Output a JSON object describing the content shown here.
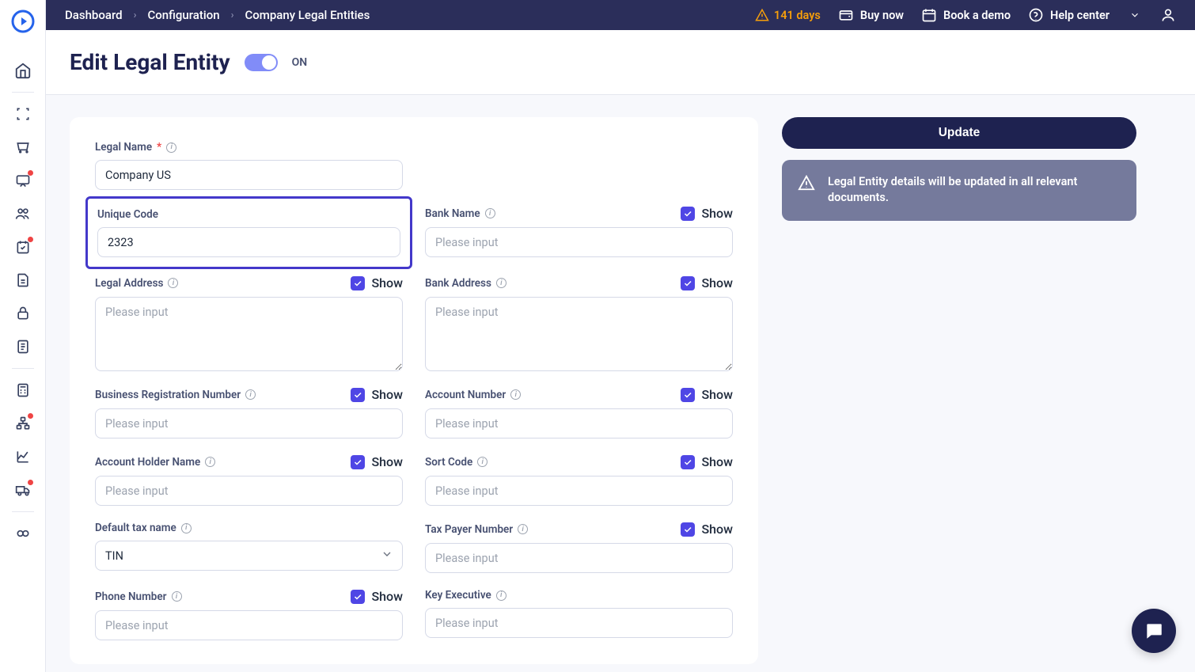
{
  "breadcrumb": [
    "Dashboard",
    "Configuration",
    "Company Legal Entities"
  ],
  "topbar": {
    "days": "141 days",
    "buy_now": "Buy now",
    "book_demo": "Book a demo",
    "help_center": "Help center"
  },
  "header": {
    "title": "Edit Legal Entity",
    "toggle_label": "ON"
  },
  "form": {
    "placeholder": "Please input",
    "show_label": "Show",
    "legal_name": {
      "label": "Legal Name",
      "value": "Company US"
    },
    "unique_code": {
      "label": "Unique Code",
      "value": "2323"
    },
    "bank_name": {
      "label": "Bank Name",
      "value": ""
    },
    "legal_address": {
      "label": "Legal Address",
      "value": ""
    },
    "bank_address": {
      "label": "Bank Address",
      "value": ""
    },
    "brn": {
      "label": "Business Registration Number",
      "value": ""
    },
    "account_number": {
      "label": "Account Number",
      "value": ""
    },
    "account_holder": {
      "label": "Account Holder Name",
      "value": ""
    },
    "sort_code": {
      "label": "Sort Code",
      "value": ""
    },
    "default_tax": {
      "label": "Default tax name",
      "value": "TIN"
    },
    "tax_payer": {
      "label": "Tax Payer Number",
      "value": ""
    },
    "phone": {
      "label": "Phone Number",
      "value": ""
    },
    "key_exec": {
      "label": "Key Executive",
      "value": ""
    }
  },
  "right": {
    "update": "Update",
    "banner": "Legal Entity details will be updated in all relevant documents."
  }
}
